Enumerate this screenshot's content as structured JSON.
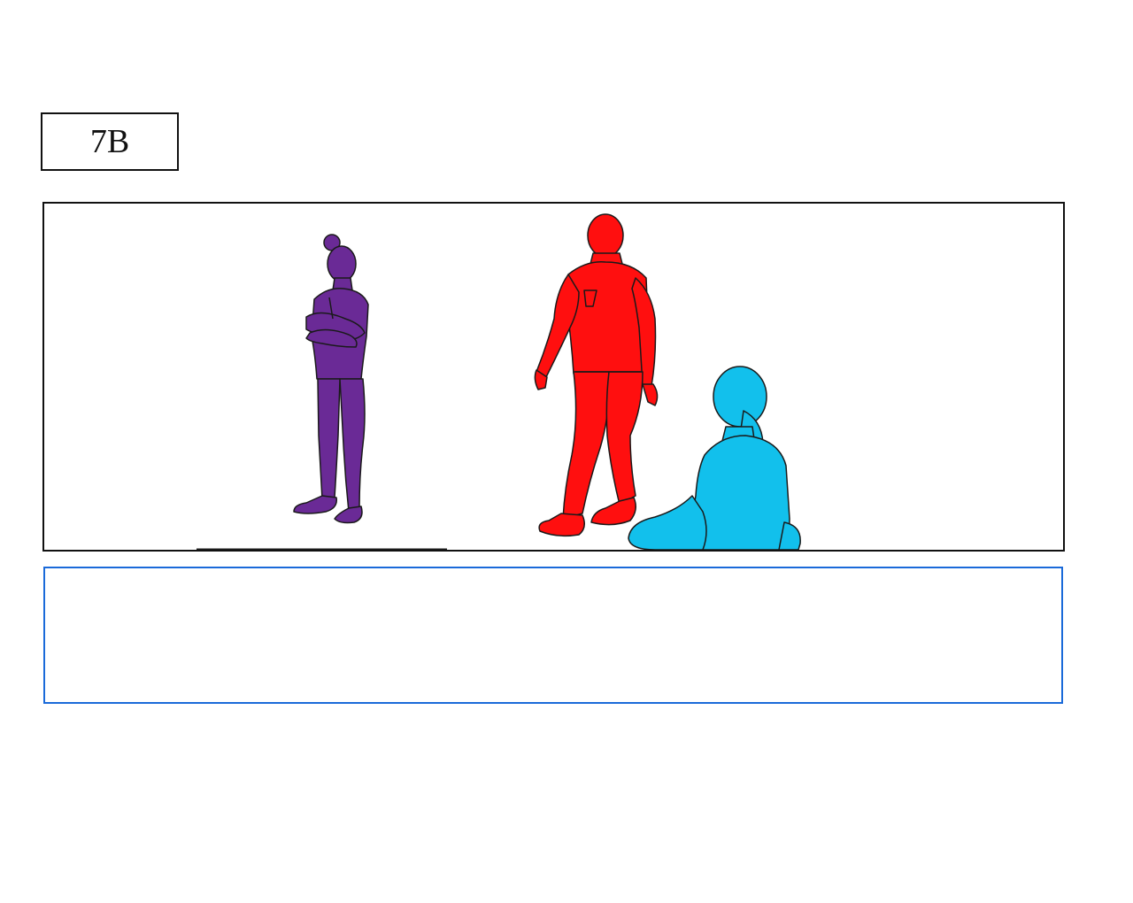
{
  "shot": {
    "label": "7B"
  },
  "panel": {
    "figures": [
      {
        "name": "standing-figure-arms-crossed",
        "color": "#6a2a96"
      },
      {
        "name": "walking-figure",
        "color": "#ff0f0f"
      },
      {
        "name": "seated-figure",
        "color": "#12c0ec"
      }
    ],
    "line_color": "#1a1a1a"
  },
  "caption": {
    "text": "",
    "border_color": "#1a6ad9"
  }
}
